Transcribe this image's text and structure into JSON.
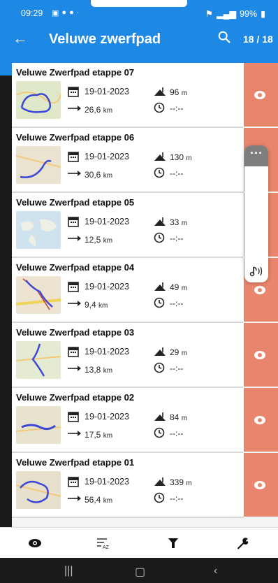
{
  "status_bar": {
    "time": "09:29",
    "battery": "99%"
  },
  "appbar": {
    "title": "Veluwe zwerfpad",
    "count": "18 / 18"
  },
  "routes": [
    {
      "name": "Veluwe Zwerfpad etappe 07",
      "date": "19-01-2023",
      "climb": "96",
      "climb_unit": "m",
      "distance": "26,6",
      "distance_unit": "km",
      "duration": "--:--"
    },
    {
      "name": "Veluwe Zwerfpad etappe 06",
      "date": "19-01-2023",
      "climb": "130",
      "climb_unit": "m",
      "distance": "30,6",
      "distance_unit": "km",
      "duration": "--:--"
    },
    {
      "name": "Veluwe Zwerfpad etappe 05",
      "date": "19-01-2023",
      "climb": "33",
      "climb_unit": "m",
      "distance": "12,5",
      "distance_unit": "km",
      "duration": "--:--"
    },
    {
      "name": "Veluwe Zwerfpad etappe 04",
      "date": "19-01-2023",
      "climb": "49",
      "climb_unit": "m",
      "distance": "9,4",
      "distance_unit": "km",
      "duration": "--:--"
    },
    {
      "name": "Veluwe Zwerfpad etappe 03",
      "date": "19-01-2023",
      "climb": "29",
      "climb_unit": "m",
      "distance": "13,8",
      "distance_unit": "km",
      "duration": "--:--"
    },
    {
      "name": "Veluwe Zwerfpad etappe 02",
      "date": "19-01-2023",
      "climb": "84",
      "climb_unit": "m",
      "distance": "17,5",
      "distance_unit": "km",
      "duration": "--:--"
    },
    {
      "name": "Veluwe Zwerfpad etappe 01",
      "date": "19-01-2023",
      "climb": "339",
      "climb_unit": "m",
      "distance": "56,4",
      "distance_unit": "km",
      "duration": "--:--"
    }
  ],
  "colors": {
    "primary": "#1e88e5",
    "side_action": "#e8856c"
  },
  "icons": {
    "side": "eye-icon",
    "toolbar": [
      "eye-icon",
      "sort-az-icon",
      "filter-icon",
      "wrench-icon"
    ]
  }
}
